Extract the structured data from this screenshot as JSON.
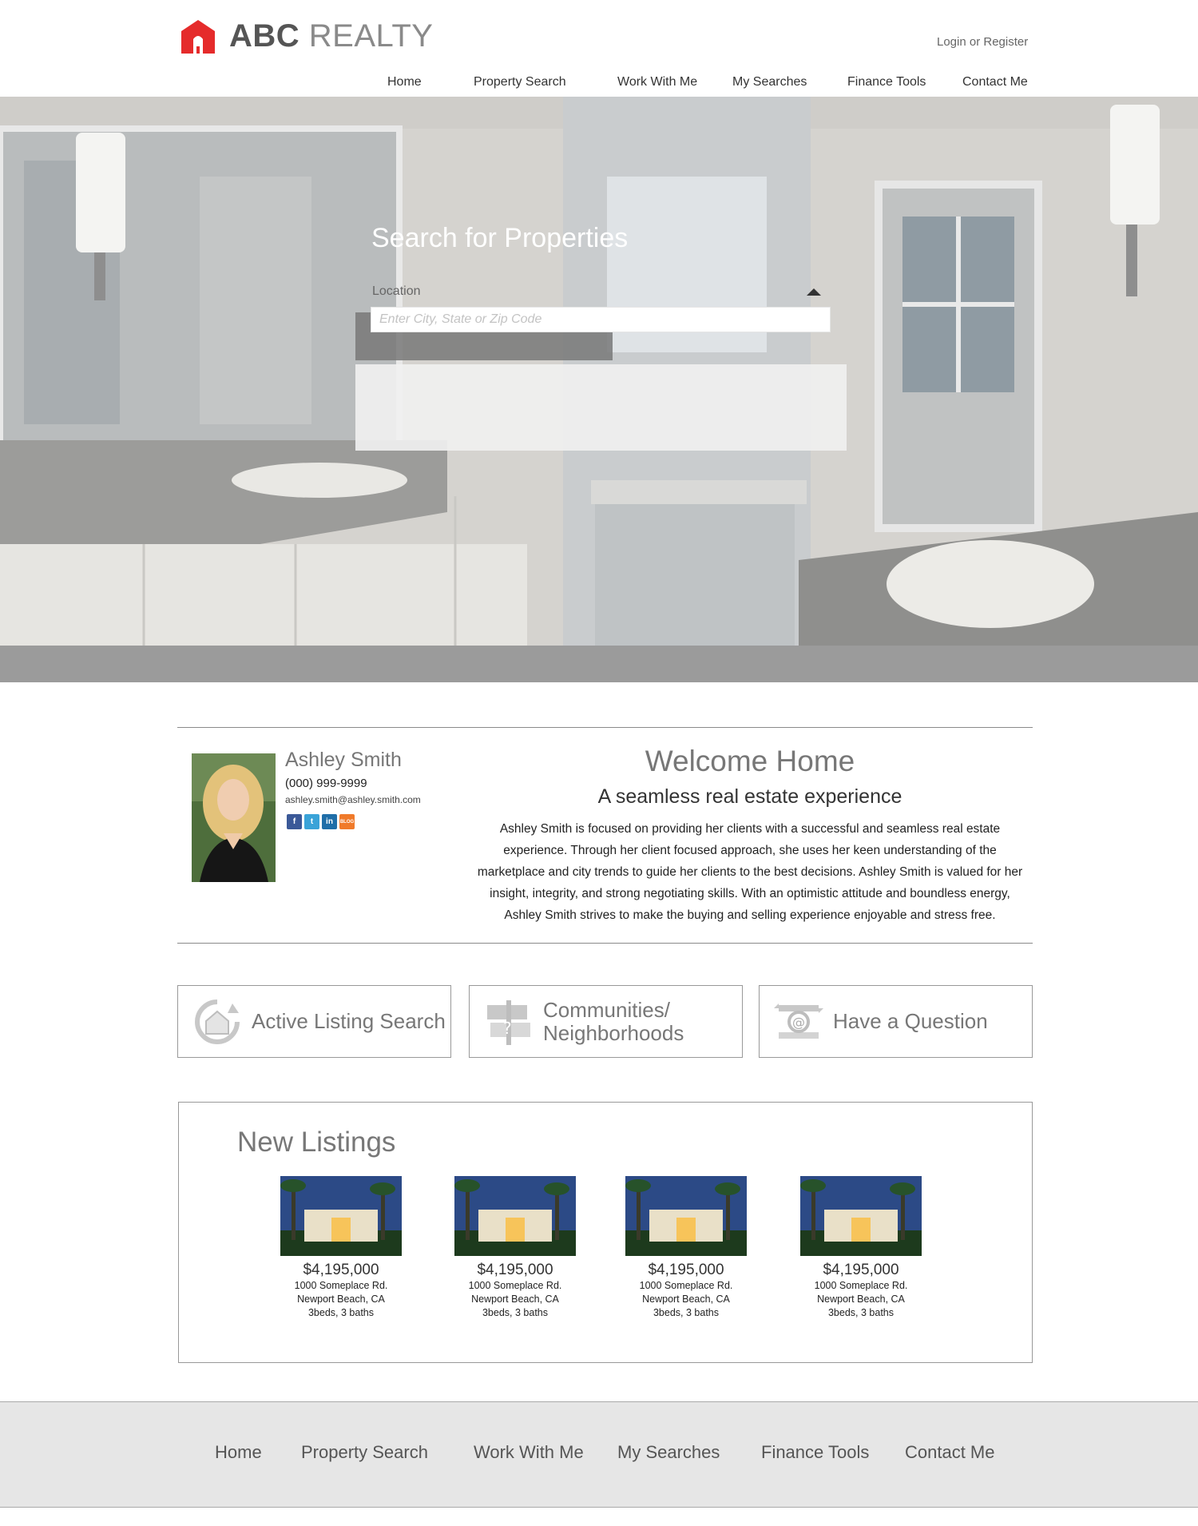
{
  "brand": {
    "logo_abc": "ABC",
    "logo_realty": "REALTY",
    "accent_color": "#e52b2b"
  },
  "header": {
    "login_label": "Login or Register"
  },
  "nav": {
    "items": [
      "Home",
      "Property Search",
      "Work With Me",
      "My Searches",
      "Finance Tools",
      "Contact Me"
    ]
  },
  "search": {
    "title": "Search for Properties",
    "location_label": "Location",
    "placeholder": "Enter City, State or Zip Code",
    "value": ""
  },
  "agent": {
    "name": "Ashley Smith",
    "phone": "(000) 999-9999",
    "email": "ashley.smith@ashley.smith.com",
    "socials": [
      {
        "icon": "facebook-icon",
        "glyph": "f",
        "color": "#3b5998"
      },
      {
        "icon": "twitter-icon",
        "glyph": "t",
        "color": "#3aa3d8"
      },
      {
        "icon": "linkedin-icon",
        "glyph": "in",
        "color": "#1f6ea8"
      },
      {
        "icon": "blog-icon",
        "glyph": "BLOG",
        "color": "#f07a2a"
      }
    ]
  },
  "welcome": {
    "title": "Welcome Home",
    "subtitle": "A seamless real estate experience",
    "body": "Ashley Smith is focused on providing her clients with a successful and seamless real estate experience. Through her client focused approach, she uses her keen understanding of the marketplace and city trends to guide her clients to the best decisions. Ashley Smith is valued for her insight, integrity, and strong negotiating skills. With an optimistic attitude and boundless  energy, Ashley Smith strives to make the buying and selling experience enjoyable and stress free."
  },
  "quick_links": [
    {
      "label": "Active Listing Search",
      "icon": "house-search-icon"
    },
    {
      "label": "Communities/ Neighborhoods",
      "icon": "community-signpost-icon"
    },
    {
      "label": "Have a Question",
      "icon": "email-at-icon"
    }
  ],
  "listings": {
    "title": "New Listings",
    "items": [
      {
        "price": "$4,195,000",
        "address": "1000 Someplace Rd.",
        "city": "Newport Beach, CA",
        "details": "3beds, 3 baths"
      },
      {
        "price": "$4,195,000",
        "address": "1000 Someplace Rd.",
        "city": "Newport Beach, CA",
        "details": "3beds, 3 baths"
      },
      {
        "price": "$4,195,000",
        "address": "1000 Someplace Rd.",
        "city": "Newport Beach, CA",
        "details": "3beds, 3 baths"
      },
      {
        "price": "$4,195,000",
        "address": "1000 Someplace Rd.",
        "city": "Newport Beach, CA",
        "details": "3beds, 3 baths"
      }
    ]
  },
  "footer": {
    "nav": [
      "Home",
      "Property Search",
      "Work With Me",
      "My Searches",
      "Finance Tools",
      "Contact Me"
    ]
  }
}
